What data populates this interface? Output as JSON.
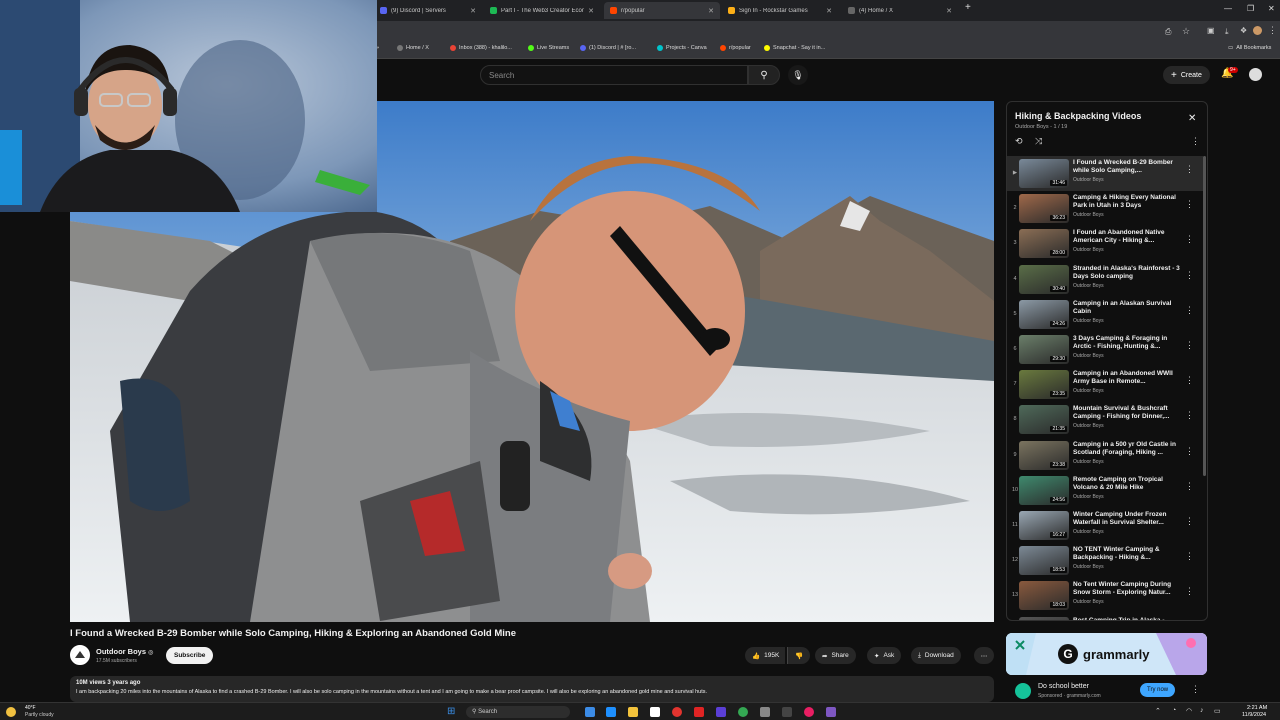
{
  "browser": {
    "tabs": [
      {
        "label": "(9) Discord | Servers",
        "color": "#5865f2"
      },
      {
        "label": "Part I - The Web3 Creator Econ",
        "color": "#1db954"
      },
      {
        "label": "r/popular",
        "color": "#ff4500"
      },
      {
        "label": "Sign In - Rockstar Games",
        "color": "#fcaf17"
      },
      {
        "label": "(4) Home / X",
        "color": "#444444"
      }
    ],
    "new_tab": "+",
    "bookmarks": [
      {
        "label": "Home / X",
        "color": "#444444"
      },
      {
        "label": "Inbox (388) - khalilo...",
        "color": "#ea4335"
      },
      {
        "label": "Live Streams",
        "color": "#53fc18"
      },
      {
        "label": "(1) Discord | # [ro...",
        "color": "#5865f2"
      },
      {
        "label": "Projects - Canva",
        "color": "#00c4cc"
      },
      {
        "label": "r/popular",
        "color": "#ff4500"
      },
      {
        "label": "Snapchat - Say it in...",
        "color": "#fffc00"
      }
    ],
    "all_bookmarks": "All Bookmarks"
  },
  "masthead": {
    "search_placeholder": "Search",
    "create_label": "Create",
    "notif_count": "9+"
  },
  "playlist": {
    "title": "Hiking & Backpacking Videos",
    "subtitle": "Outdoor Boys - 1 / 19",
    "items": [
      {
        "idx": "",
        "title": "I Found a Wrecked B-29 Bomber while Solo Camping,...",
        "channel": "Outdoor Boys",
        "duration": "31:46",
        "thumb": "#7a8a9a"
      },
      {
        "idx": "2",
        "title": "Camping & Hiking Every National Park in Utah in 3 Days",
        "channel": "Outdoor Boys",
        "duration": "36:23",
        "thumb": "#a0694a"
      },
      {
        "idx": "3",
        "title": "I Found an Abandoned Native American City - Hiking &...",
        "channel": "Outdoor Boys",
        "duration": "28:00",
        "thumb": "#8b6e55"
      },
      {
        "idx": "4",
        "title": "Stranded in Alaska's Rainforest - 3 Days Solo camping",
        "channel": "Outdoor Boys",
        "duration": "30:40",
        "thumb": "#5a6e48"
      },
      {
        "idx": "5",
        "title": "Camping in an Alaskan Survival Cabin",
        "channel": "Outdoor Boys",
        "duration": "24:26",
        "thumb": "#8c9aa6"
      },
      {
        "idx": "6",
        "title": "3 Days Camping & Foraging in Arctic - Fishing, Hunting &...",
        "channel": "Outdoor Boys",
        "duration": "29:30",
        "thumb": "#6b7f6a"
      },
      {
        "idx": "7",
        "title": "Camping in an Abandoned WWII Army Base in Remote...",
        "channel": "Outdoor Boys",
        "duration": "23:35",
        "thumb": "#6a7a3e"
      },
      {
        "idx": "8",
        "title": "Mountain Survival & Bushcraft Camping - Fishing for Dinner,...",
        "channel": "Outdoor Boys",
        "duration": "21:35",
        "thumb": "#4f6a5a"
      },
      {
        "idx": "9",
        "title": "Camping in a 500 yr Old Castle in Scotland (Foraging, Hiking ...",
        "channel": "Outdoor Boys",
        "duration": "23:38",
        "thumb": "#7b7460"
      },
      {
        "idx": "10",
        "title": "Remote Camping on Tropical Volcano & 20 Mile Hike",
        "channel": "Outdoor Boys",
        "duration": "24:56",
        "thumb": "#3f8a6e"
      },
      {
        "idx": "11",
        "title": "Winter Camping Under Frozen Waterfall in Survival Shelter...",
        "channel": "Outdoor Boys",
        "duration": "16:27",
        "thumb": "#9aa8b4"
      },
      {
        "idx": "12",
        "title": "NO TENT Winter Camping & Backpacking - Hiking &...",
        "channel": "Outdoor Boys",
        "duration": "18:53",
        "thumb": "#7d8a96"
      },
      {
        "idx": "13",
        "title": "No Tent Winter Camping During Snow Storm - Exploring Natur...",
        "channel": "Outdoor Boys",
        "duration": "18:03",
        "thumb": "#8a5a3e"
      },
      {
        "idx": "14",
        "title": "Best Camping Trip in Alaska -",
        "channel": "",
        "duration": "",
        "thumb": "#555555"
      }
    ]
  },
  "video": {
    "title": "I Found a Wrecked B-29 Bomber while Solo Camping, Hiking & Exploring an Abandoned Gold Mine",
    "channel": "Outdoor Boys",
    "verified": "◎",
    "subscribers": "17.5M subscribers",
    "subscribe_label": "Subscribe",
    "likes": "195K",
    "share_label": "Share",
    "ask_label": "Ask",
    "download_label": "Download",
    "views_meta": "10M views  3 years ago",
    "description": "I am backpacking 20 miles into the mountains of Alaska to find a crashed B-29 Bomber. I will also be solo camping in the mountains without a tent and I am going to make a bear proof campsite. I will also be exploring an abandoned gold mine and survival huts."
  },
  "ad": {
    "brand": "grammarly",
    "title": "Do school better",
    "sponsor": "Sponsored · grammarly.com",
    "cta": "Try now"
  },
  "taskbar": {
    "weather_temp": "40°F",
    "weather_desc": "Partly cloudy",
    "search_label": "Search",
    "time": "2:21 AM",
    "date": "11/9/2024"
  },
  "colors": {
    "accent": "#3ea6ff",
    "bg": "#0f0f0f",
    "pill": "#272727"
  }
}
